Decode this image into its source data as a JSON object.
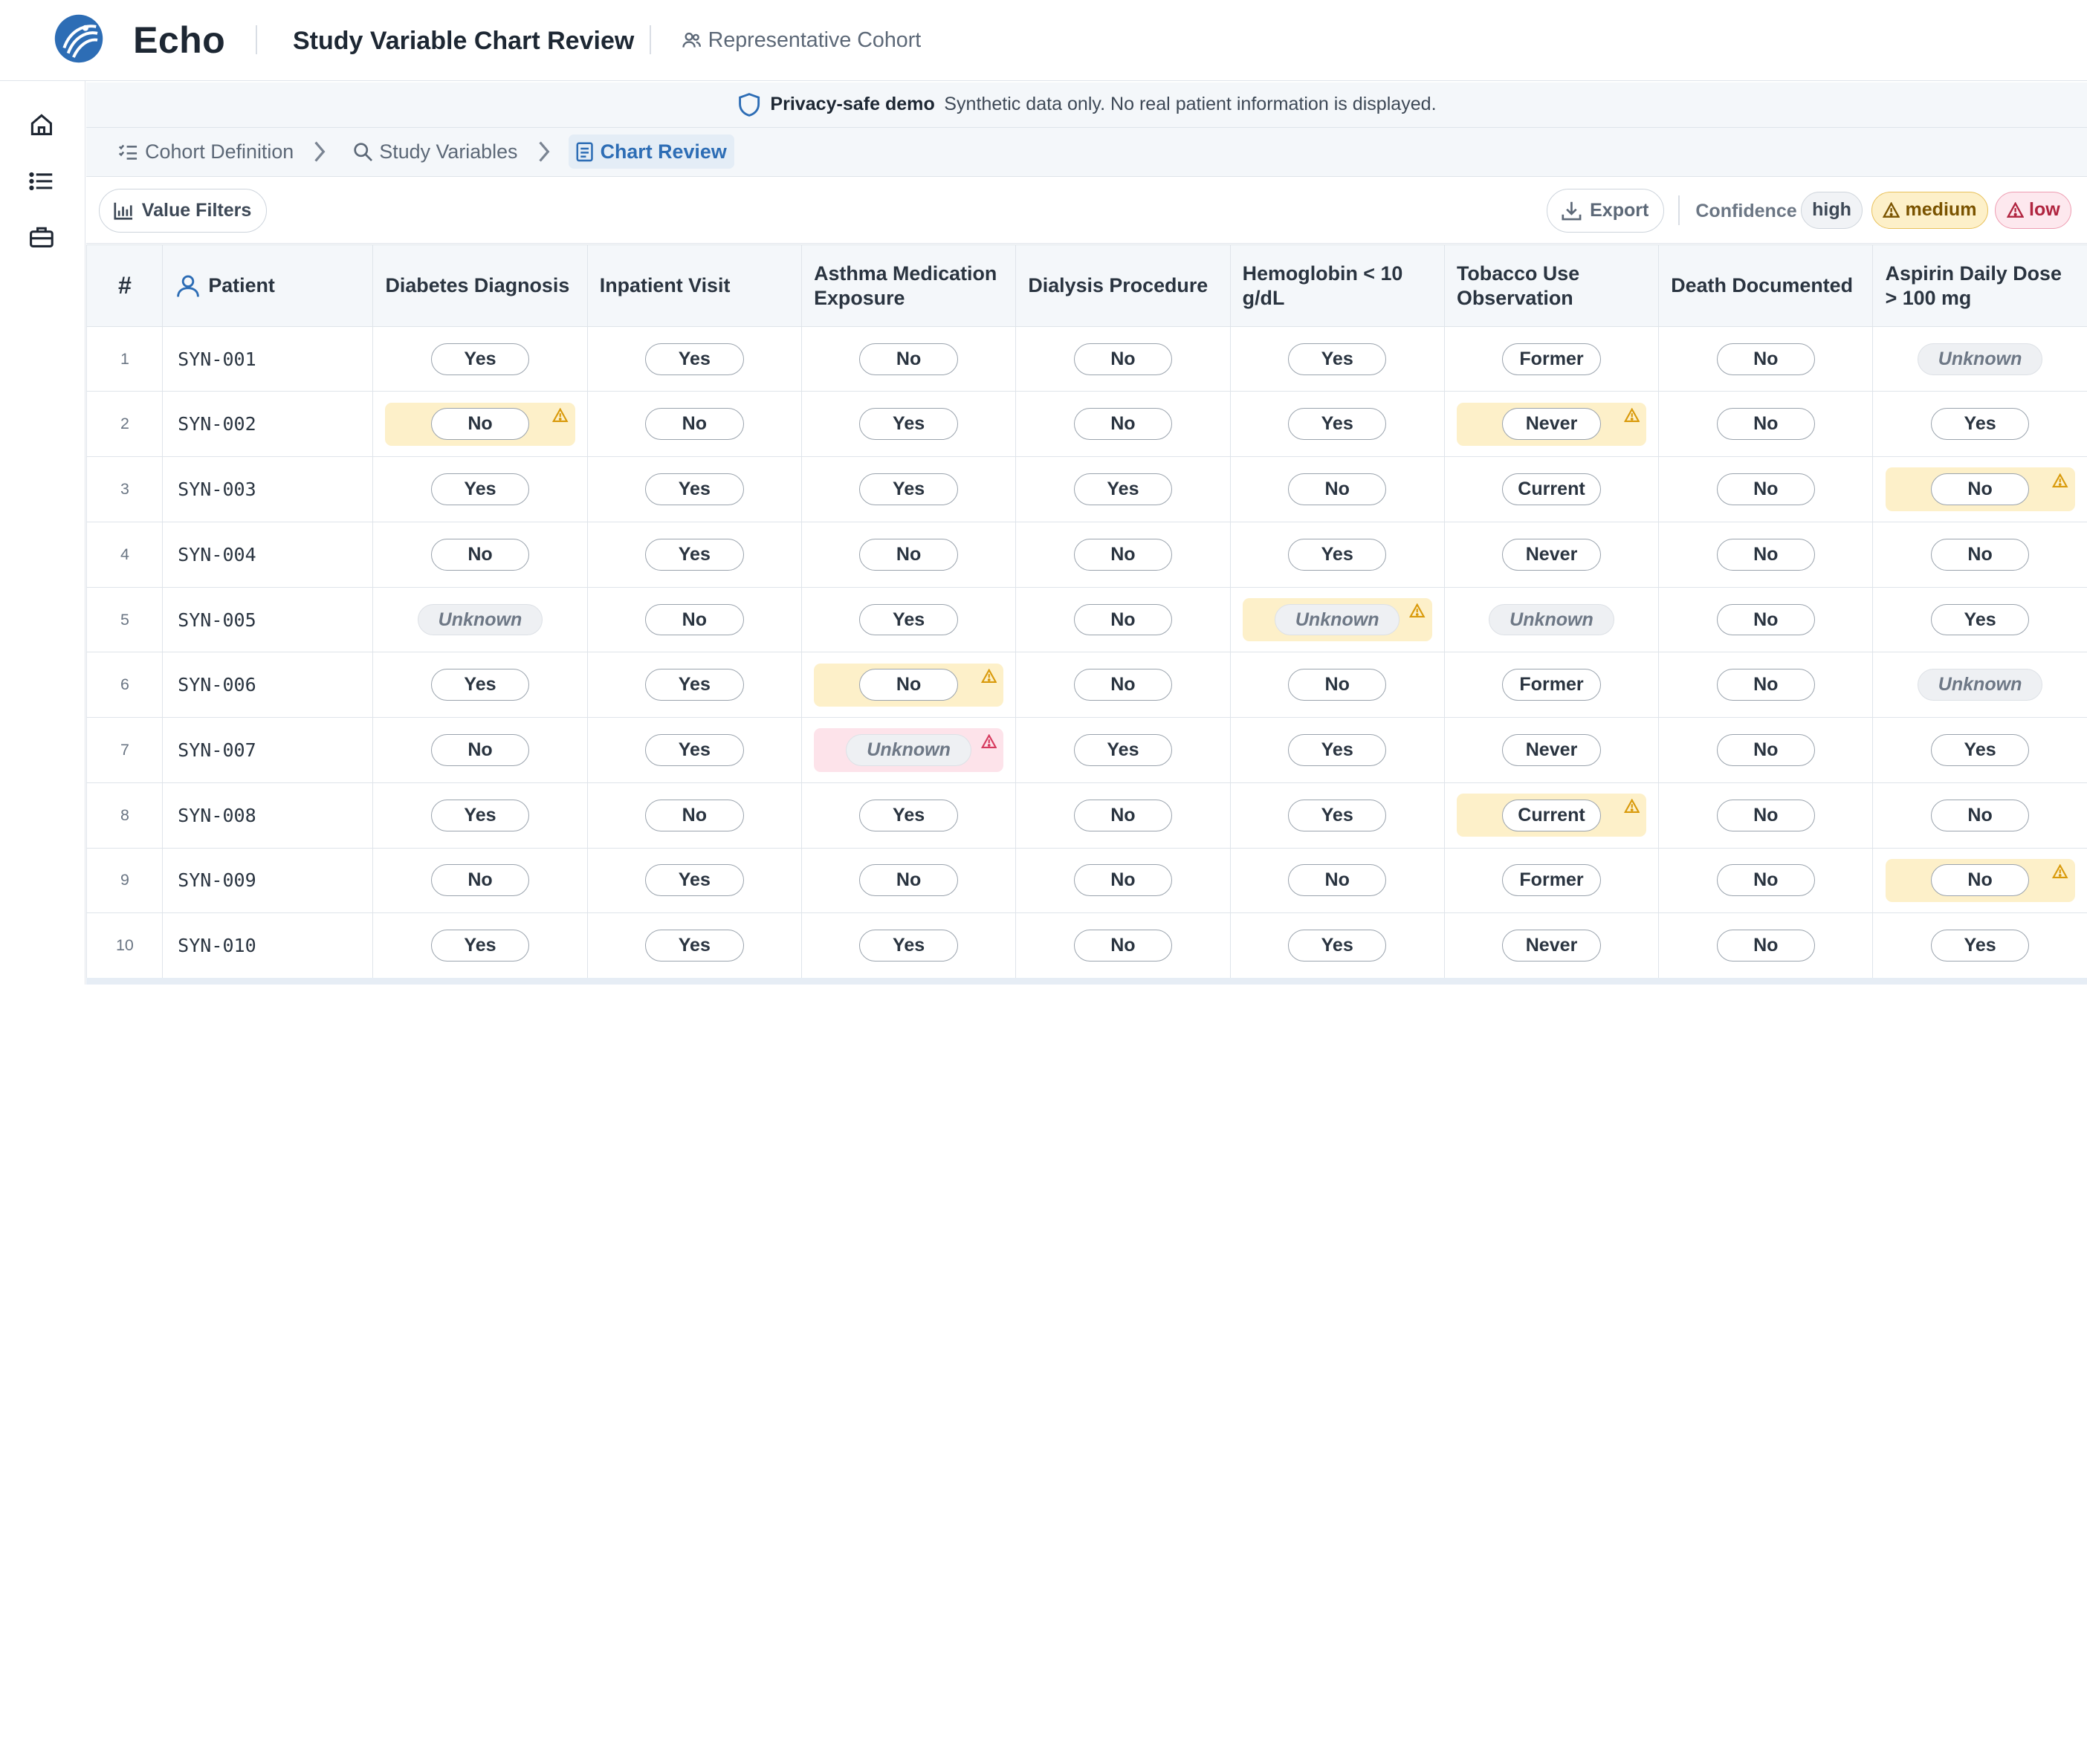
{
  "app": {
    "name": "Echo",
    "title": "Study Variable Chart Review",
    "cohort": "Representative Cohort"
  },
  "sidebar": {
    "items": [
      "home-icon",
      "list-icon",
      "briefcase-icon"
    ]
  },
  "privacy": {
    "strong": "Privacy-safe demo",
    "text": "Synthetic data only. No real patient information is displayed."
  },
  "breadcrumb": [
    "Cohort Definition",
    "Study Variables",
    "Chart Review"
  ],
  "toolbar": {
    "value_filters": "Value Filters",
    "export": "Export",
    "confidence_label": "Confidence",
    "levels": {
      "high": "high",
      "medium": "medium",
      "low": "low"
    }
  },
  "colors": {
    "accent": "#2d6db5",
    "medium_bg": "#fdf0c9",
    "low_bg": "#fde3ea",
    "warn_medium": "#d99a0b",
    "warn_low": "#d63a5e"
  },
  "table": {
    "num_header": "#",
    "patient_header": "Patient",
    "columns": [
      "Diabetes Diagnosis",
      "Inpatient Visit",
      "Asthma Medication Exposure",
      "Dialysis Procedure",
      "Hemoglobin < 10 g/dL",
      "Tobacco Use Observation",
      "Death Documented",
      "Aspirin Daily Dose > 100 mg"
    ],
    "rows": [
      {
        "n": "1",
        "id": "SYN-001",
        "cells": [
          {
            "v": "Yes"
          },
          {
            "v": "Yes"
          },
          {
            "v": "No"
          },
          {
            "v": "No"
          },
          {
            "v": "Yes"
          },
          {
            "v": "Former"
          },
          {
            "v": "No"
          },
          {
            "v": "Unknown"
          }
        ]
      },
      {
        "n": "2",
        "id": "SYN-002",
        "cells": [
          {
            "v": "No",
            "c": "medium"
          },
          {
            "v": "No"
          },
          {
            "v": "Yes"
          },
          {
            "v": "No"
          },
          {
            "v": "Yes"
          },
          {
            "v": "Never",
            "c": "medium"
          },
          {
            "v": "No"
          },
          {
            "v": "Yes"
          }
        ]
      },
      {
        "n": "3",
        "id": "SYN-003",
        "cells": [
          {
            "v": "Yes"
          },
          {
            "v": "Yes"
          },
          {
            "v": "Yes"
          },
          {
            "v": "Yes"
          },
          {
            "v": "No"
          },
          {
            "v": "Current"
          },
          {
            "v": "No"
          },
          {
            "v": "No",
            "c": "medium"
          }
        ]
      },
      {
        "n": "4",
        "id": "SYN-004",
        "cells": [
          {
            "v": "No"
          },
          {
            "v": "Yes"
          },
          {
            "v": "No"
          },
          {
            "v": "No"
          },
          {
            "v": "Yes"
          },
          {
            "v": "Never"
          },
          {
            "v": "No"
          },
          {
            "v": "No"
          }
        ]
      },
      {
        "n": "5",
        "id": "SYN-005",
        "cells": [
          {
            "v": "Unknown"
          },
          {
            "v": "No"
          },
          {
            "v": "Yes"
          },
          {
            "v": "No"
          },
          {
            "v": "Unknown",
            "c": "medium"
          },
          {
            "v": "Unknown"
          },
          {
            "v": "No"
          },
          {
            "v": "Yes"
          }
        ]
      },
      {
        "n": "6",
        "id": "SYN-006",
        "cells": [
          {
            "v": "Yes"
          },
          {
            "v": "Yes"
          },
          {
            "v": "No",
            "c": "medium"
          },
          {
            "v": "No"
          },
          {
            "v": "No"
          },
          {
            "v": "Former"
          },
          {
            "v": "No"
          },
          {
            "v": "Unknown"
          }
        ]
      },
      {
        "n": "7",
        "id": "SYN-007",
        "cells": [
          {
            "v": "No"
          },
          {
            "v": "Yes"
          },
          {
            "v": "Unknown",
            "c": "low"
          },
          {
            "v": "Yes"
          },
          {
            "v": "Yes"
          },
          {
            "v": "Never"
          },
          {
            "v": "No"
          },
          {
            "v": "Yes"
          }
        ]
      },
      {
        "n": "8",
        "id": "SYN-008",
        "cells": [
          {
            "v": "Yes"
          },
          {
            "v": "No"
          },
          {
            "v": "Yes"
          },
          {
            "v": "No"
          },
          {
            "v": "Yes"
          },
          {
            "v": "Current",
            "c": "medium"
          },
          {
            "v": "No"
          },
          {
            "v": "No"
          }
        ]
      },
      {
        "n": "9",
        "id": "SYN-009",
        "cells": [
          {
            "v": "No"
          },
          {
            "v": "Yes"
          },
          {
            "v": "No"
          },
          {
            "v": "No"
          },
          {
            "v": "No"
          },
          {
            "v": "Former"
          },
          {
            "v": "No"
          },
          {
            "v": "No",
            "c": "medium"
          }
        ]
      },
      {
        "n": "10",
        "id": "SYN-010",
        "cells": [
          {
            "v": "Yes"
          },
          {
            "v": "Yes"
          },
          {
            "v": "Yes"
          },
          {
            "v": "No"
          },
          {
            "v": "Yes"
          },
          {
            "v": "Never"
          },
          {
            "v": "No"
          },
          {
            "v": "Yes"
          }
        ]
      }
    ]
  }
}
